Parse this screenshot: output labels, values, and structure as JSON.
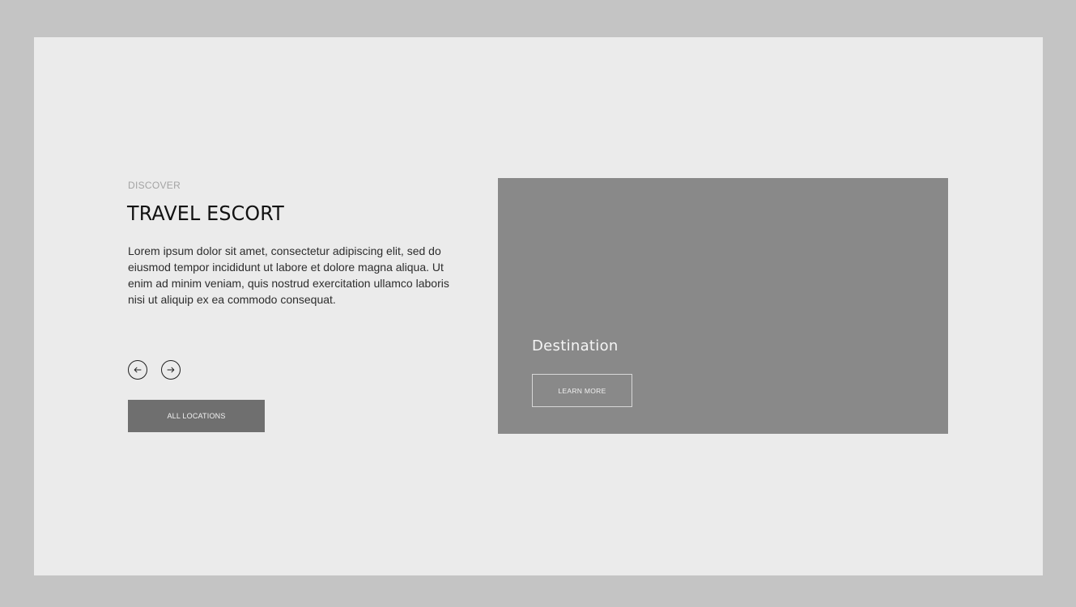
{
  "hero": {
    "eyebrow": "DISCOVER",
    "title": "TRAVEL ESCORT",
    "description": "Lorem ipsum dolor sit amet, consectetur adipiscing elit, sed do eiusmod tempor incididunt ut labore et dolore magna aliqua. Ut enim ad minim veniam, quis nostrud exercitation ullamco laboris nisi ut aliquip ex ea commodo consequat.",
    "prev_icon": "arrow-left-circle-icon",
    "next_icon": "arrow-right-circle-icon",
    "button_label": "ALL LOCATIONS"
  },
  "card": {
    "title": "Destination",
    "button_label": "LEARN MORE"
  },
  "colors": {
    "outer_background": "#c4c4c4",
    "canvas_background": "#ebebeb",
    "card_background": "#898989",
    "primary_button": "#6f6f6f",
    "text_dark": "#121212",
    "text_muted": "#a3a3a3"
  }
}
